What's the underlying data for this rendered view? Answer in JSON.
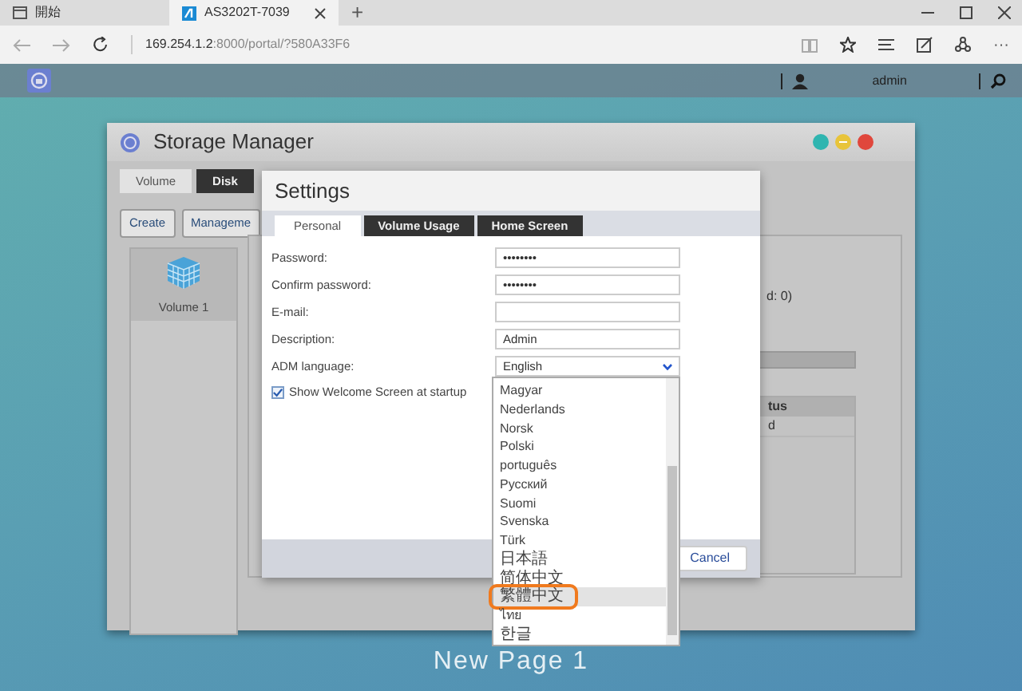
{
  "browser": {
    "tabs": [
      {
        "title": "開始",
        "selected": false
      },
      {
        "title": "AS3202T-7039",
        "selected": true
      }
    ],
    "new_tab": "+",
    "more": "···",
    "address": {
      "host": "169.254.1.2",
      "rest": ":8000/portal/?580A33F6"
    }
  },
  "topbar": {
    "user": "admin"
  },
  "storage_manager": {
    "title": "Storage Manager",
    "tabs": [
      {
        "label": "Volume",
        "selected": true
      },
      {
        "label": "Disk",
        "selected": false
      }
    ],
    "buttons": [
      "Create",
      "Manageme"
    ],
    "volumes": [
      {
        "label": "Volume 1",
        "selected": true
      }
    ],
    "detail_fragment": "d: 0)",
    "table": {
      "header_fragment": "tus",
      "row_fragment": "d"
    }
  },
  "settings": {
    "title": "Settings",
    "tabs": [
      {
        "label": "Personal",
        "selected": true
      },
      {
        "label": "Volume Usage",
        "selected": false
      },
      {
        "label": "Home Screen",
        "selected": false
      }
    ],
    "fields": [
      {
        "label": "Password:",
        "value": "••••••••"
      },
      {
        "label": "Confirm password:",
        "value": "••••••••"
      },
      {
        "label": "E-mail:"
      },
      {
        "label": "Description:",
        "value": "Admin"
      }
    ],
    "language": {
      "label": "ADM language:",
      "value": "English"
    },
    "welcome_checkbox": {
      "label": "Show Welcome Screen at startup",
      "checked": true
    },
    "cancel": "Cancel"
  },
  "language_list": [
    {
      "label": "Magyar",
      "selected": false,
      "circled": false
    },
    {
      "label": "Nederlands",
      "selected": false,
      "circled": false
    },
    {
      "label": "Norsk",
      "selected": false,
      "circled": false
    },
    {
      "label": "Polski",
      "selected": false,
      "circled": false
    },
    {
      "label": "português",
      "selected": false,
      "circled": false
    },
    {
      "label": "Русский",
      "selected": false,
      "circled": false
    },
    {
      "label": "Suomi",
      "selected": false,
      "circled": false
    },
    {
      "label": "Svenska",
      "selected": false,
      "circled": false
    },
    {
      "label": "Türk",
      "selected": false,
      "circled": false
    },
    {
      "label": "日本語",
      "selected": false,
      "circled": false
    },
    {
      "label": "简体中文",
      "selected": false,
      "circled": false
    },
    {
      "label": "繁體中文",
      "selected": true,
      "circled": true
    },
    {
      "label": "ไทย",
      "selected": false,
      "circled": false
    },
    {
      "label": "한글",
      "selected": false,
      "circled": false
    }
  ],
  "caption": "New Page 1"
}
